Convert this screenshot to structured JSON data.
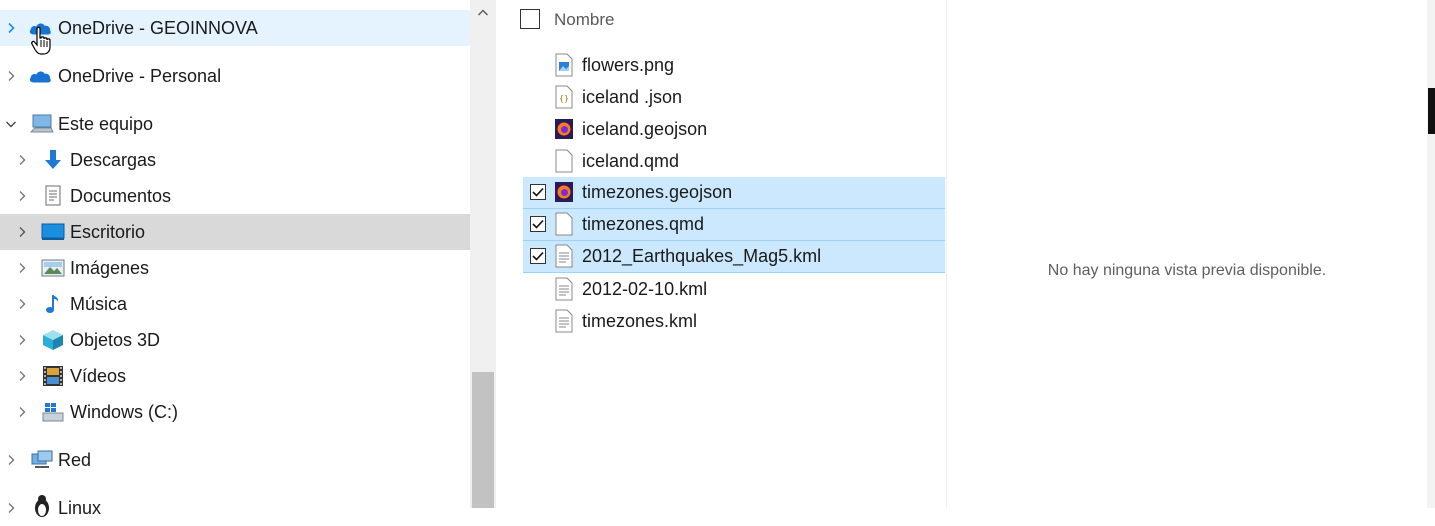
{
  "nav": {
    "items": [
      {
        "label": "OneDrive - GEOINNOVA",
        "icon": "onedrive-cloud-icon"
      },
      {
        "label": "OneDrive - Personal",
        "icon": "onedrive-cloud-icon"
      },
      {
        "label": "Este equipo",
        "icon": "computer-icon"
      },
      {
        "label": "Descargas",
        "icon": "download-arrow-icon"
      },
      {
        "label": "Documentos",
        "icon": "documents-icon"
      },
      {
        "label": "Escritorio",
        "icon": "desktop-icon"
      },
      {
        "label": "Imágenes",
        "icon": "pictures-icon"
      },
      {
        "label": "Música",
        "icon": "music-note-icon"
      },
      {
        "label": "Objetos 3D",
        "icon": "cube-3d-icon"
      },
      {
        "label": "Vídeos",
        "icon": "film-strip-icon"
      },
      {
        "label": "Windows (C:)",
        "icon": "windows-drive-icon"
      },
      {
        "label": "Red",
        "icon": "network-icon"
      },
      {
        "label": "Linux",
        "icon": "linux-penguin-icon"
      }
    ]
  },
  "files": {
    "column_name": "Nombre",
    "items": [
      {
        "name": "flowers.png",
        "type": "image",
        "checked": false
      },
      {
        "name": "iceland .json",
        "type": "json",
        "checked": false
      },
      {
        "name": "iceland.geojson",
        "type": "firefox",
        "checked": false
      },
      {
        "name": "iceland.qmd",
        "type": "blank",
        "checked": false
      },
      {
        "name": "timezones.geojson",
        "type": "firefox",
        "checked": true
      },
      {
        "name": "timezones.qmd",
        "type": "blank",
        "checked": true
      },
      {
        "name": "2012_Earthquakes_Mag5.kml",
        "type": "text",
        "checked": true
      },
      {
        "name": "2012-02-10.kml",
        "type": "text",
        "checked": false
      },
      {
        "name": "timezones.kml",
        "type": "text",
        "checked": false
      }
    ]
  },
  "preview": {
    "message": "No hay ninguna vista previa disponible."
  },
  "colors": {
    "hover_bg": "#e5f3ff",
    "selected_nav_bg": "#d9d9d9",
    "selected_row_bg": "#cce8ff",
    "onedrive_blue": "#0f6cbd"
  }
}
